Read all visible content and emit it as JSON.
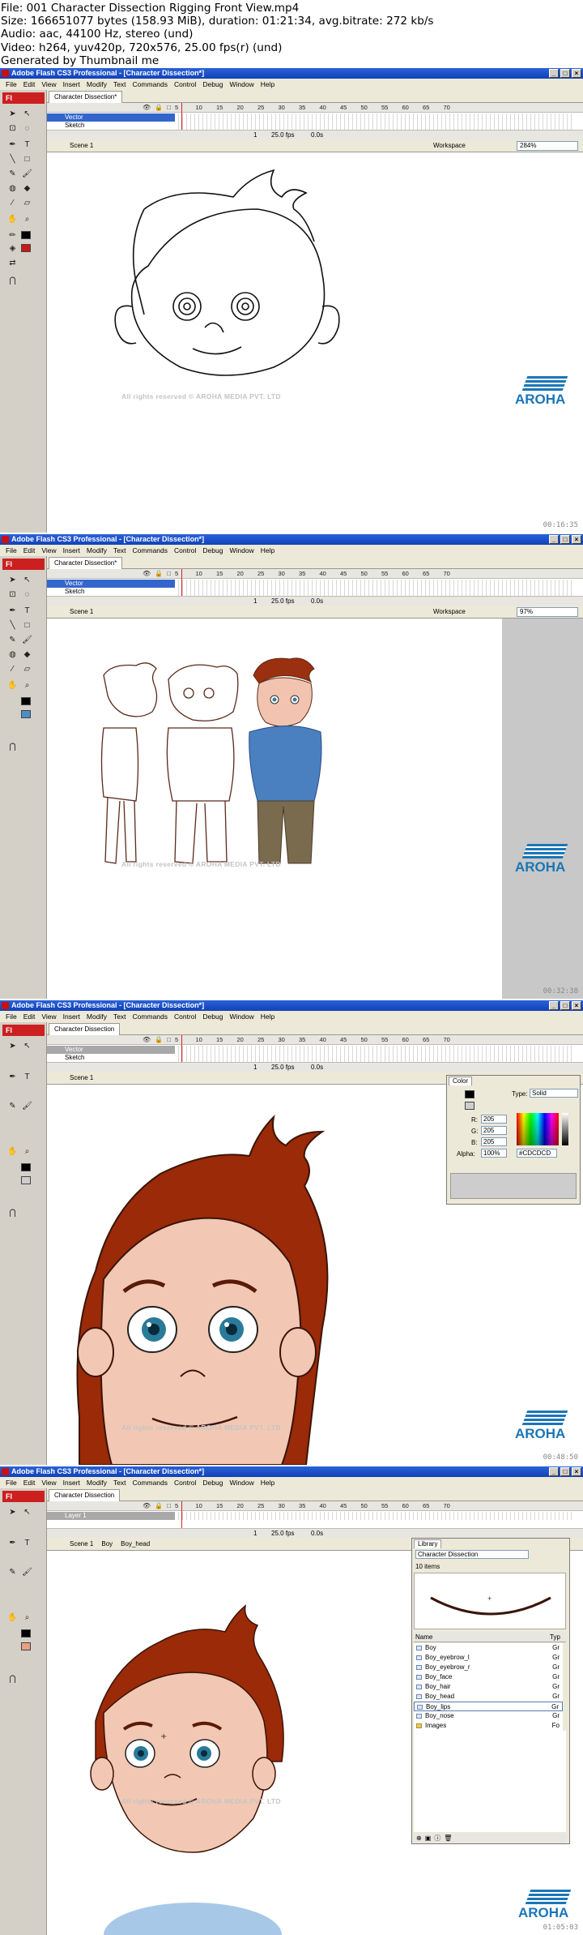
{
  "info": {
    "line1": "File: 001 Character Dissection  Rigging Front View.mp4",
    "line2": "Size: 166651077 bytes (158.93 MiB), duration: 01:21:34, avg.bitrate: 272 kb/s",
    "line3": "Audio: aac, 44100 Hz, stereo (und)",
    "line4": "Video: h264, yuv420p, 720x576, 25.00 fps(r) (und)",
    "line5": "Generated by Thumbnail me"
  },
  "app": {
    "title": "Adobe Flash CS3 Professional - [Character Dissection*]",
    "menu": [
      "File",
      "Edit",
      "View",
      "Insert",
      "Modify",
      "Text",
      "Commands",
      "Control",
      "Debug",
      "Window",
      "Help"
    ],
    "doc_tab": "Character Dissection*",
    "doc_tab_clean": "Character Dissection",
    "logo_text": "Fl",
    "ruler": [
      "5",
      "10",
      "15",
      "20",
      "25",
      "30",
      "35",
      "40",
      "45",
      "50",
      "55",
      "60",
      "65",
      "70"
    ],
    "frame_no": "1",
    "fps": "25.0 fps",
    "time": "0.0s",
    "workspace": "Workspace",
    "copyright": "All rights reserved © AROHA MEDIA PVT. LTD",
    "brand": "AROHA",
    "colors": {
      "accent": "#1a76b8",
      "hair": "#8b2500",
      "skin": "#f0c8b4",
      "shirt": "#4a80c0",
      "pants": "#7a6a4e"
    }
  },
  "frames": [
    {
      "layers": [
        "Vector",
        "Sketch"
      ],
      "scene": "Scene 1",
      "zoom": "284%",
      "timecode": "00:16:35"
    },
    {
      "layers": [
        "Vector",
        "Sketch"
      ],
      "scene": "Scene 1",
      "zoom": "97%",
      "timecode": "00:32:38"
    },
    {
      "layers": [
        "Vector",
        "Sketch"
      ],
      "scene": "Scene 1",
      "timecode": "00:48:50",
      "color_panel": {
        "tab": "Color",
        "type_label": "Type:",
        "type_value": "Solid",
        "r_label": "R:",
        "r": "205",
        "g_label": "G:",
        "g": "205",
        "b_label": "B:",
        "b": "205",
        "alpha_label": "Alpha:",
        "alpha": "100%",
        "hex": "#CDCDCD"
      }
    },
    {
      "layers": [
        "Layer 1"
      ],
      "breadcrumb": [
        "Scene 1",
        "Boy",
        "Boy_head"
      ],
      "timecode": "01:05:03",
      "library": {
        "tab": "Library",
        "doc": "Character Dissection",
        "count": "10 items",
        "col_name": "Name",
        "col_type": "Typ",
        "items": [
          {
            "name": "Boy",
            "type": "Gr"
          },
          {
            "name": "Boy_eyebrow_l",
            "type": "Gr"
          },
          {
            "name": "Boy_eyebrow_r",
            "type": "Gr"
          },
          {
            "name": "Boy_face",
            "type": "Gr"
          },
          {
            "name": "Boy_hair",
            "type": "Gr"
          },
          {
            "name": "Boy_head",
            "type": "Gr"
          },
          {
            "name": "Boy_lips",
            "type": "Gr"
          },
          {
            "name": "Boy_nose",
            "type": "Gr"
          },
          {
            "name": "Images",
            "type": "Fo"
          }
        ]
      }
    }
  ]
}
